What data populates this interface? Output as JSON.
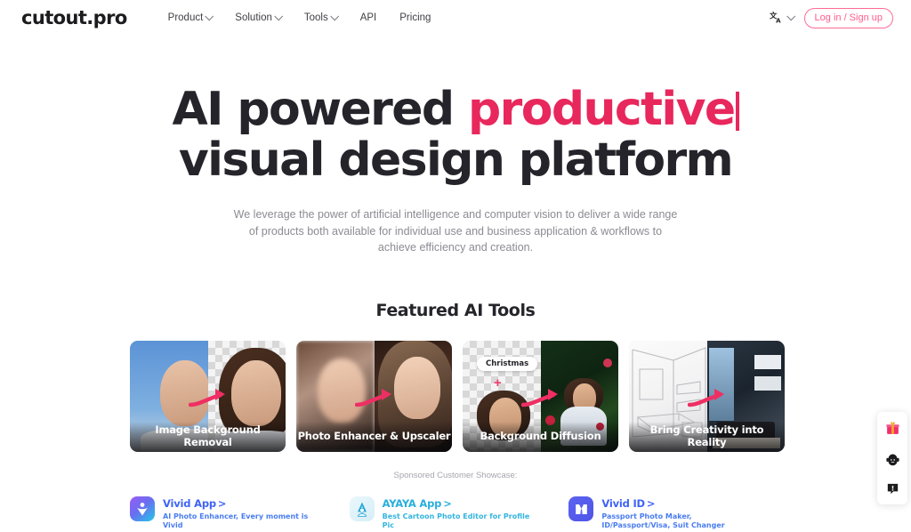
{
  "header": {
    "logo": "cutout.pro",
    "nav": [
      {
        "label": "Product",
        "has_caret": true
      },
      {
        "label": "Solution",
        "has_caret": true
      },
      {
        "label": "Tools",
        "has_caret": true
      },
      {
        "label": "API",
        "has_caret": false
      },
      {
        "label": "Pricing",
        "has_caret": false
      }
    ],
    "language_icon": "translate-icon",
    "login_label": "Log in / Sign up",
    "accent_pink": "#ff5c8d"
  },
  "hero": {
    "title_part1": "AI powered ",
    "title_highlight": "productive",
    "title_line2": "visual design platform",
    "highlight_color": "#e8275c",
    "subtitle": "We leverage the power of artificial intelligence and computer vision to deliver a wide range of products both available for individual use and business application & workflows to achieve efficiency and creation."
  },
  "featured": {
    "title": "Featured AI Tools",
    "cards": [
      {
        "label": "Image Background Removal",
        "prompt": ""
      },
      {
        "label": "Photo Enhancer & Upscaler",
        "prompt": ""
      },
      {
        "label": "Background Diffusion",
        "prompt": "Christmas"
      },
      {
        "label": "Bring Creativity into Reality",
        "prompt": ""
      }
    ]
  },
  "sponsors": {
    "title": "Sponsored Customer Showcase:",
    "items": [
      {
        "name": "Vivid App",
        "arrow": ">",
        "desc": "AI Photo Enhancer, Every moment is Vivid",
        "icon": "vivid-app-icon",
        "color": "#3f63f5"
      },
      {
        "name": "AYAYA App",
        "arrow": ">",
        "desc": "Best Cartoon Photo Editor for Profile Pic",
        "icon": "ayaya-app-icon",
        "color": "#29aedd"
      },
      {
        "name": "Vivid ID",
        "arrow": ">",
        "desc": "Passport Photo Maker, ID/Passport/Visa, Suit Changer",
        "icon": "vivid-id-icon",
        "color": "#3f63f5"
      }
    ]
  },
  "float_widget": {
    "buttons": [
      {
        "icon": "gift-icon"
      },
      {
        "icon": "support-agent-icon"
      },
      {
        "icon": "feedback-icon"
      }
    ]
  }
}
